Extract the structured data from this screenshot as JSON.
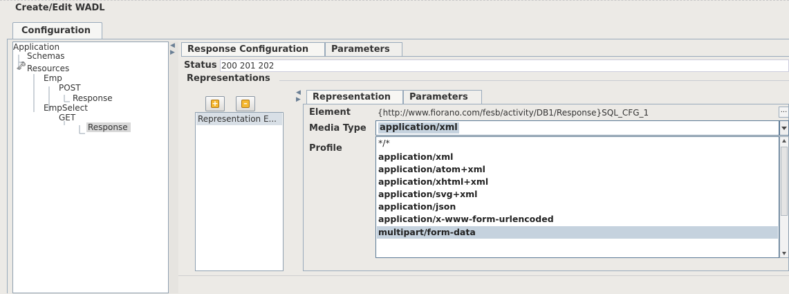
{
  "window": {
    "title": "Create/Edit WADL"
  },
  "top_tab": {
    "label": "Configuration"
  },
  "tree": {
    "items": [
      {
        "label": "Application"
      },
      {
        "label": "Schemas"
      },
      {
        "label": "Resources"
      },
      {
        "label": "Emp"
      },
      {
        "label": "POST"
      },
      {
        "label": "Response"
      },
      {
        "label": "EmpSelect"
      },
      {
        "label": "GET"
      },
      {
        "label": "Response"
      }
    ],
    "selected": "Response"
  },
  "response_tabs": [
    {
      "label": "Response Configuration",
      "active": true
    },
    {
      "label": "Parameters",
      "active": false
    }
  ],
  "status": {
    "label": "Status",
    "value": "200 201 202"
  },
  "representations": {
    "label": "Representations",
    "add_icon": "add-icon",
    "remove_icon": "remove-icon",
    "items": [
      {
        "label": "Representation E..."
      }
    ]
  },
  "representation_tabs": [
    {
      "label": "Representation",
      "active": true
    },
    {
      "label": "Parameters",
      "active": false
    }
  ],
  "element": {
    "label": "Element",
    "value": "{http://www.fiorano.com/fesb/activity/DB1/Response}SQL_CFG_1",
    "button_label": "..."
  },
  "media_type": {
    "label": "Media Type",
    "value": "application/xml",
    "options": [
      "*/*",
      "application/xml",
      "application/atom+xml",
      "application/xhtml+xml",
      "application/svg+xml",
      "application/json",
      "application/x-www-form-urlencoded",
      "multipart/form-data"
    ],
    "highlighted": "multipart/form-data"
  },
  "profile": {
    "label": "Profile"
  },
  "colors": {
    "selection": "#c5d2de",
    "tab_border": "#99aabb"
  }
}
